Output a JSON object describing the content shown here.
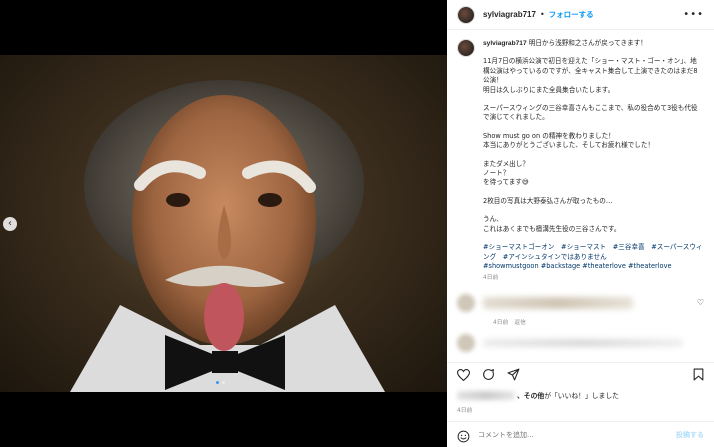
{
  "header": {
    "username": "sylviagrab717",
    "separator": "•",
    "follow_label": "フォローする",
    "more_icon": "more-horizontal-icon"
  },
  "caption": {
    "username": "sylviagrab717",
    "first_line": "明日から浅野和之さんが戻ってきます！",
    "paragraphs": [
      "11月7日の横浜公演で初日を迎えた「ショー・マスト・ゴー・オン」、地構公演はやっているのですが、全キャスト集合して上演できたのはまだ8公演！\n明日は久しぶりにまた全員集合いたします。",
      "スーパースウィングの三谷幸喜さんもここまで、私の役合めて3役も代役で演じてくれました。",
      "Show must go on の精神を教わりました！\n本当にありがとうございました、そしてお疲れ様でした！",
      "またダメ出し？\nノート？\nを待ってます😅",
      "2枚目の写真は大野泰弘さんが取ったもの…",
      "うん、\nこれはあくまでも檀溝先生役の三谷さんです。"
    ],
    "hashtags": "#ショーマストゴーオン　#ショーマスト　#三谷幸喜　#スーパースウィング　#アインシュタインではありません\n#showmustgoon #backstage #theaterlove #theaterlove",
    "time": "4日前"
  },
  "comment": {
    "meta_time": "4日前",
    "meta_reply": "返信"
  },
  "likes": {
    "suffix": "、その他",
    "text_after": "が「いいね！」しました"
  },
  "posted": "4日前",
  "comment_input": {
    "placeholder": "コメントを追加...",
    "post_label": "投稿する"
  },
  "icons": [
    "heart-icon",
    "comment-icon",
    "share-icon",
    "bookmark-icon",
    "smile-icon",
    "chevron-left-icon"
  ],
  "colors": {
    "accent": "#0095f6",
    "link": "#00376b",
    "muted": "#8e8e8e"
  }
}
